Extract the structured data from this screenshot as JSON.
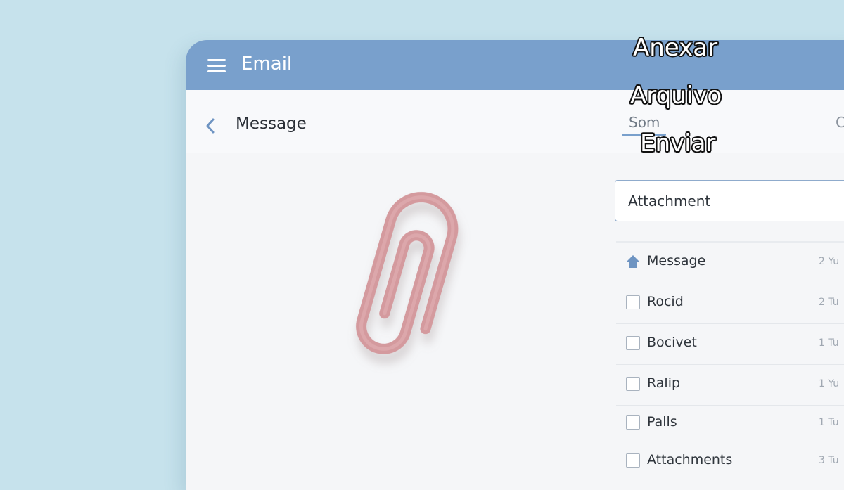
{
  "app": {
    "title": "Email"
  },
  "subheader": {
    "title": "Message",
    "tab_som": "Som",
    "tab_partial": "C"
  },
  "overlay": {
    "line1": "Anexar",
    "line2": "Arquivo",
    "line3": "Enviar"
  },
  "search": {
    "value": "Attachment"
  },
  "list": [
    {
      "label": "Message",
      "meta": "2 Yu",
      "icon": "home-icon"
    },
    {
      "label": "Rocid",
      "meta": "2 Tu",
      "icon": "checkbox"
    },
    {
      "label": "Bocivet",
      "meta": "1 Tu",
      "icon": "checkbox"
    },
    {
      "label": "Ralip",
      "meta": "1 Yu",
      "icon": "checkbox"
    },
    {
      "label": "Palls",
      "meta": "1 Tu",
      "icon": "checkbox"
    },
    {
      "label": "Attachments",
      "meta": "3 Tu",
      "icon": "checkbox"
    }
  ],
  "colors": {
    "background": "#c6e2ec",
    "appbar": "#79a0cc",
    "paperclip": "#d49a9e",
    "accent": "#79a0cc"
  }
}
